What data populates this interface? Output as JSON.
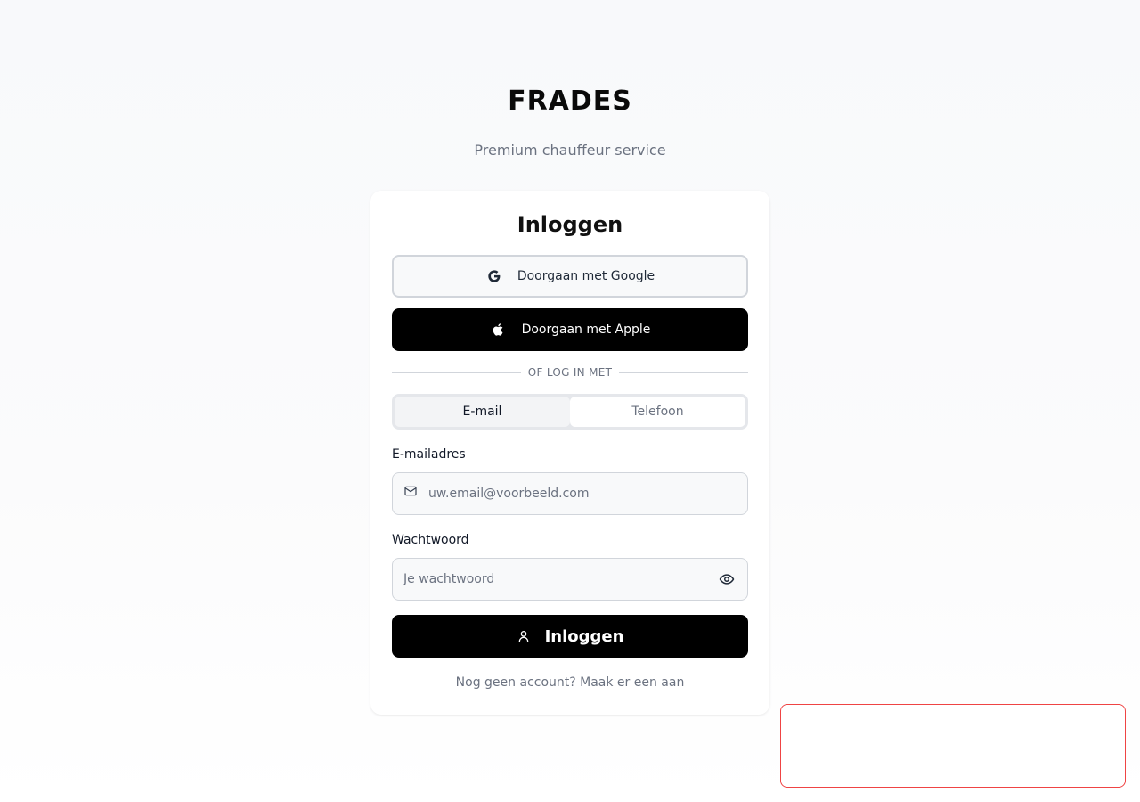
{
  "brand": {
    "name": "FRADES",
    "tagline": "Premium chauffeur service"
  },
  "login": {
    "title": "Inloggen",
    "google_label": "Doorgaan met Google",
    "apple_label": "Doorgaan met Apple",
    "divider_text": "OF LOG IN MET",
    "tabs": [
      {
        "label": "E-mail",
        "active": true
      },
      {
        "label": "Telefoon",
        "active": false
      }
    ],
    "email": {
      "label": "E-mailadres",
      "placeholder": "uw.email@voorbeeld.com",
      "value": ""
    },
    "password": {
      "label": "Wachtwoord",
      "placeholder": "Je wachtwoord",
      "value": ""
    },
    "submit_label": "Inloggen",
    "signup_text": "Nog geen account? Maak er een aan"
  },
  "icons": {
    "google": "google-icon",
    "apple": "apple-icon",
    "mail": "mail-icon",
    "eye": "eye-icon",
    "user": "user-icon"
  },
  "colors": {
    "primary": "#000000",
    "muted_text": "#6b7280",
    "toast_border": "#ef4444"
  }
}
